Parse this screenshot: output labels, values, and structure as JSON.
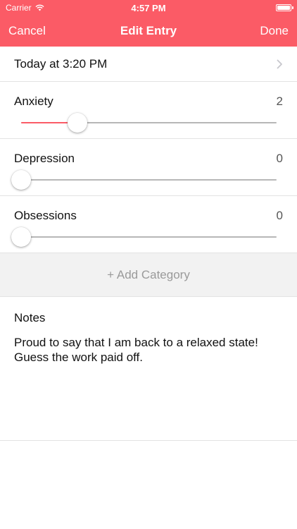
{
  "status_bar": {
    "carrier": "Carrier",
    "time": "4:57 PM",
    "wifi_icon": "wifi-icon",
    "battery_icon": "battery-icon"
  },
  "nav": {
    "cancel_label": "Cancel",
    "title": "Edit Entry",
    "done_label": "Done"
  },
  "date_row": {
    "label": "Today at 3:20 PM",
    "icon": "chevron-right-icon"
  },
  "categories": [
    {
      "name": "Anxiety",
      "value": "2",
      "fraction": 0.22
    },
    {
      "name": "Depression",
      "value": "0",
      "fraction": 0
    },
    {
      "name": "Obsessions",
      "value": "0",
      "fraction": 0
    }
  ],
  "add_category_label": "+ Add Category",
  "notes": {
    "label": "Notes",
    "text": "Proud to say that I am back to a relaxed state!\nGuess the work paid off."
  },
  "colors": {
    "accent": "#fb5b66",
    "track": "#b7b7b7",
    "add_bg": "#f2f2f2"
  }
}
